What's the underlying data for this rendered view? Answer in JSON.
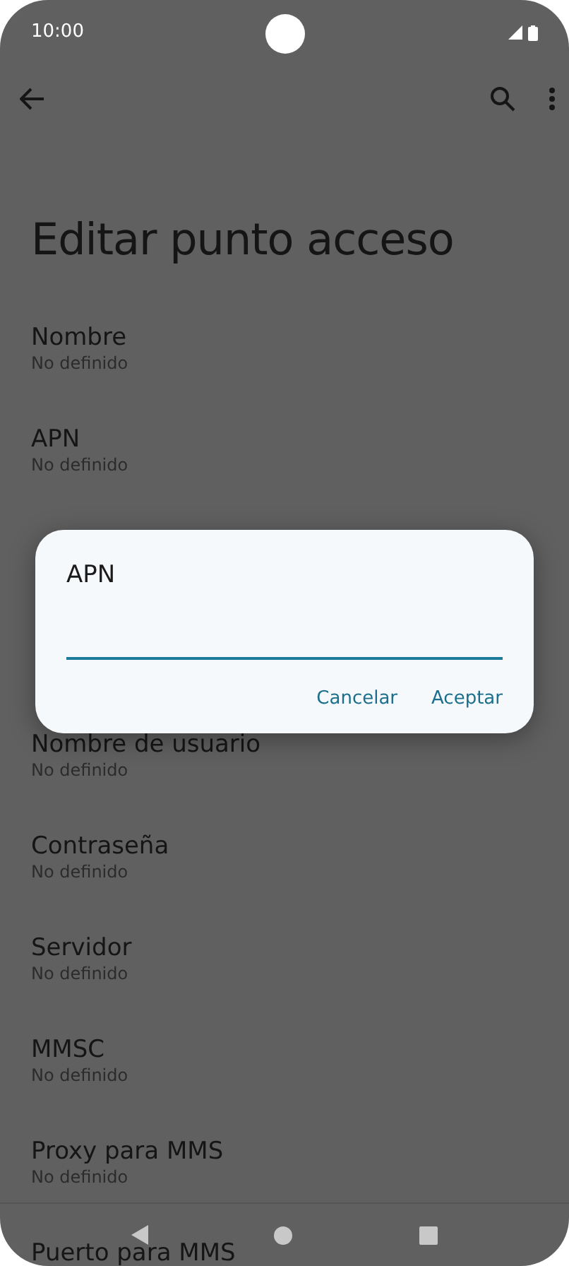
{
  "status_bar": {
    "time": "10:00"
  },
  "screen_title": "Editar punto acceso",
  "fields_top": [
    {
      "label": "Nombre",
      "value": "No definido"
    },
    {
      "label": "APN",
      "value": "No definido"
    }
  ],
  "fields_bottom": [
    {
      "label": "Nombre de usuario",
      "value": "No definido"
    },
    {
      "label": "Contraseña",
      "value": "No definido"
    },
    {
      "label": "Servidor",
      "value": "No definido"
    },
    {
      "label": "MMSC",
      "value": "No definido"
    },
    {
      "label": "Proxy para MMS",
      "value": "No definido"
    },
    {
      "label": "Puerto para MMS"
    }
  ],
  "dialog": {
    "title": "APN",
    "buttons": [
      "Cancelar",
      "Aceptar"
    ]
  }
}
